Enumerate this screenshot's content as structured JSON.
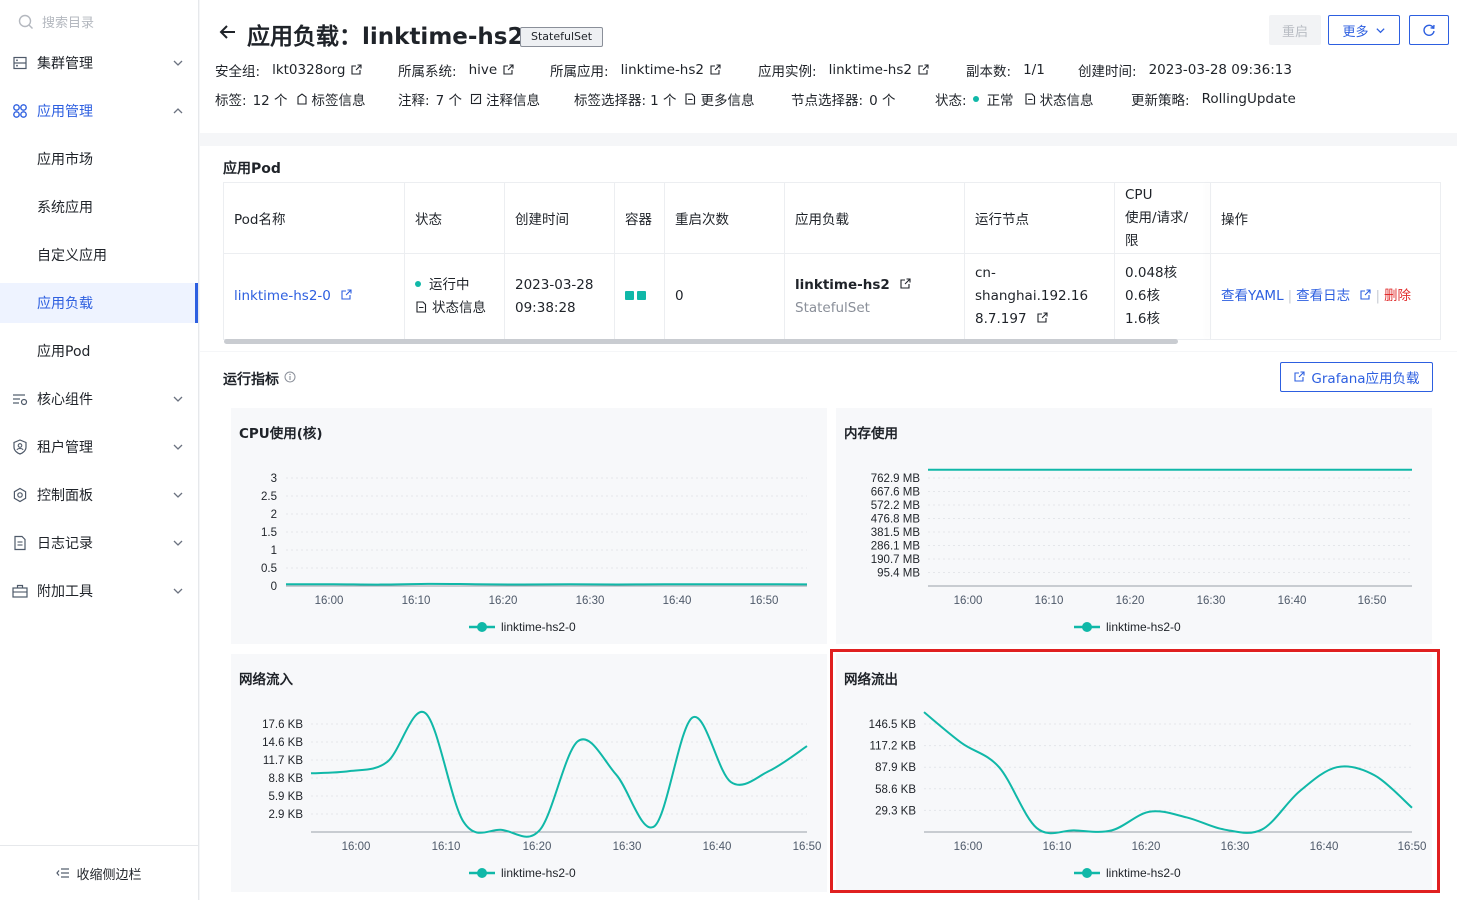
{
  "sidebar": {
    "search_placeholder": "搜索目录",
    "items": [
      {
        "label": "集群管理",
        "icon": "server-icon"
      },
      {
        "label": "应用管理",
        "icon": "apps-icon"
      },
      {
        "label": "核心组件",
        "icon": "components-icon"
      },
      {
        "label": "租户管理",
        "icon": "tenant-icon"
      },
      {
        "label": "控制面板",
        "icon": "gear-icon"
      },
      {
        "label": "日志记录",
        "icon": "log-icon"
      },
      {
        "label": "附加工具",
        "icon": "toolbox-icon"
      }
    ],
    "sub_items": [
      "应用市场",
      "系统应用",
      "自定义应用",
      "应用负载",
      "应用Pod"
    ],
    "active_sub": "应用负载",
    "collapse_label": "收缩侧边栏"
  },
  "header": {
    "title": "应用负载：linktime-hs2",
    "kind": "StatefulSet",
    "restart_label": "重启",
    "more_label": "更多",
    "meta_row1": [
      {
        "k": "安全组:",
        "v": "lkt0328org",
        "ext": true
      },
      {
        "k": "所属系统:",
        "v": "hive",
        "ext": true
      },
      {
        "k": "所属应用:",
        "v": "linktime-hs2",
        "ext": true
      },
      {
        "k": "应用实例:",
        "v": "linktime-hs2",
        "ext": true
      },
      {
        "k": "副本数:",
        "v": "1/1",
        "ext": false
      },
      {
        "k": "创建时间:",
        "v": "2023-03-28 09:36:13",
        "ext": false
      }
    ],
    "labels": {
      "k": "标签:",
      "count": "12 个",
      "link": "标签信息"
    },
    "annotations": {
      "k": "注释:",
      "count": "7 个",
      "link": "注释信息"
    },
    "selector": {
      "k": "标签选择器:",
      "count": "1 个",
      "link": "更多信息"
    },
    "node_selector": {
      "k": "节点选择器:",
      "count": "0 个"
    },
    "status": {
      "k": "状态:",
      "v": "正常",
      "link": "状态信息"
    },
    "strategy": {
      "k": "更新策略:",
      "v": "RollingUpdate"
    }
  },
  "pods": {
    "title": "应用Pod",
    "columns": [
      "Pod名称",
      "状态",
      "创建时间",
      "容器",
      "重启次数",
      "应用负载",
      "运行节点",
      "CPU\n使用/请求/限",
      "操作"
    ],
    "cpu_col_line1": "CPU",
    "cpu_col_line2": "使用/请求/限",
    "row": {
      "name": "linktime-hs2-0",
      "status": "运行中",
      "status_link": "状态信息",
      "created_date": "2023-03-28",
      "created_time": "09:38:28",
      "restarts": "0",
      "workload": "linktime-hs2",
      "workload_kind": "StatefulSet",
      "node_line1": "cn-shanghai.192.16",
      "node_line2": "8.7.197",
      "cpu_use": "0.048核",
      "cpu_req": "0.6核",
      "cpu_lim": "1.6核",
      "op_yaml": "查看YAML",
      "op_log": "查看日志",
      "op_delete": "删除"
    }
  },
  "metrics": {
    "title": "运行指标",
    "grafana_label": "Grafana应用负载"
  },
  "chart_data": [
    {
      "type": "line",
      "title": "CPU使用(核)",
      "x": [
        "16:00",
        "16:10",
        "16:20",
        "16:30",
        "16:40",
        "16:50"
      ],
      "yticks": [
        "3",
        "2.5",
        "2",
        "1.5",
        "1",
        "0.5",
        "0"
      ],
      "ylim": [
        0,
        3
      ],
      "series": [
        {
          "name": "linktime-hs2-0",
          "values": [
            0.048,
            0.05,
            0.04,
            0.06,
            0.05,
            0.04,
            0.05,
            0.04,
            0.05,
            0.048,
            0.05,
            0.045
          ]
        }
      ]
    },
    {
      "type": "line",
      "title": "内存使用",
      "x": [
        "16:00",
        "16:10",
        "16:20",
        "16:30",
        "16:40",
        "16:50"
      ],
      "yticks": [
        "762.9 MB",
        "667.6 MB",
        "572.2 MB",
        "476.8 MB",
        "381.5 MB",
        "286.1 MB",
        "190.7 MB",
        "95.4 MB"
      ],
      "ylim": [
        0,
        762.9
      ],
      "series": [
        {
          "name": "linktime-hs2-0",
          "values": [
            730,
            730,
            730,
            730,
            730,
            730,
            730,
            730,
            730,
            730,
            730,
            730
          ]
        }
      ]
    },
    {
      "type": "line",
      "title": "网络流入",
      "x": [
        "16:00",
        "16:10",
        "16:20",
        "16:30",
        "16:40",
        "16:50"
      ],
      "yticks": [
        "17.6 KB",
        "14.6 KB",
        "11.7 KB",
        "8.8 KB",
        "5.9 KB",
        "2.9 KB"
      ],
      "ylim": [
        0,
        17.6
      ],
      "series": [
        {
          "name": "linktime-hs2-0",
          "values": [
            8.2,
            8.5,
            9.8,
            16.6,
            1.4,
            0.3,
            0.3,
            12.7,
            8.0,
            0.8,
            16.0,
            7.0,
            8.5,
            12.0
          ]
        }
      ]
    },
    {
      "type": "line",
      "title": "网络流出",
      "x": [
        "16:00",
        "16:10",
        "16:20",
        "16:30",
        "16:40",
        "16:50"
      ],
      "yticks": [
        "146.5 KB",
        "117.2 KB",
        "87.9 KB",
        "58.6 KB",
        "29.3 KB"
      ],
      "ylim": [
        0,
        160
      ],
      "series": [
        {
          "name": "linktime-hs2-0",
          "values": [
            148,
            110,
            80,
            5,
            2,
            2,
            25,
            18,
            3,
            3,
            50,
            80,
            70,
            30
          ]
        }
      ]
    }
  ],
  "colors": {
    "accent": "#2d5fe0",
    "series": "#10b8a8",
    "danger": "#e02d2d"
  }
}
